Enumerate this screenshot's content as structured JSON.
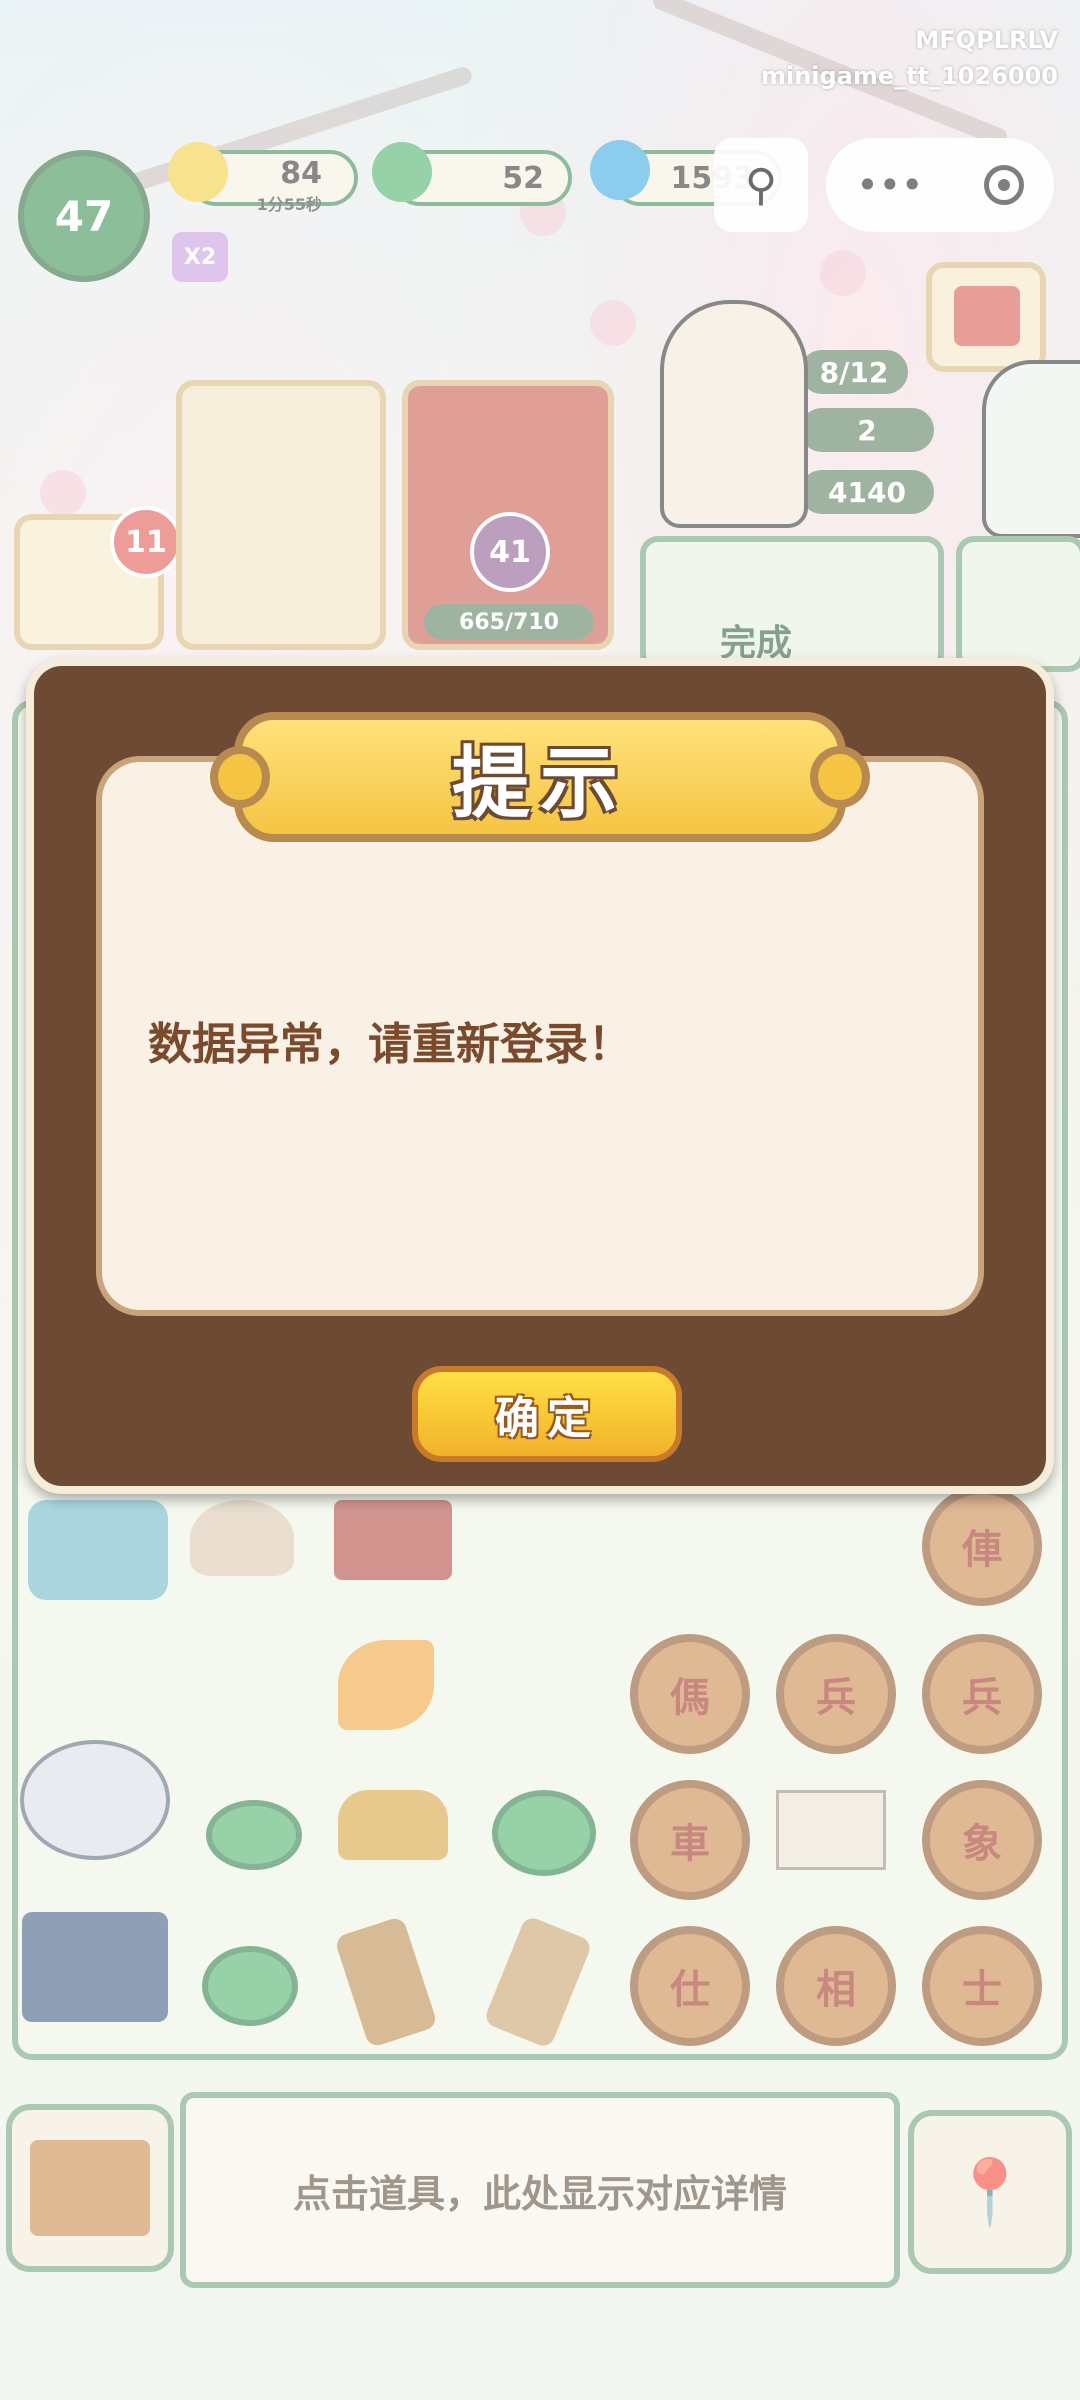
{
  "watermark": {
    "line1": "MFQPLRLV",
    "line2": "minigame_tt_1026000"
  },
  "hud": {
    "level": "47",
    "energy": {
      "value": "84",
      "timer": "1分55秒",
      "icon": "lightning-icon"
    },
    "coins": {
      "value": "52",
      "icon": "jade-coin-icon"
    },
    "gems": {
      "value": "1593",
      "icon": "flame-icon"
    },
    "multiplier": "X2"
  },
  "side_panel": {
    "progress": "8/12",
    "flowers": "2",
    "score": "4140"
  },
  "cards": {
    "notification_count": "11",
    "trophy_level": "41",
    "trophy_progress": "665/710",
    "complete_label": "完成"
  },
  "dialog": {
    "title": "提示",
    "message": "数据异常，请重新登录！",
    "confirm": "确定"
  },
  "board": {
    "chess_pieces": [
      "俥",
      "傌",
      "兵",
      "兵",
      "車",
      "象",
      "仕",
      "相",
      "士"
    ]
  },
  "bottom": {
    "detail_hint": "点击道具，此处显示对应详情"
  },
  "colors": {
    "board_border": "#6fa37a",
    "dialog_frame": "#6d4a34",
    "button": "#f2b12b"
  }
}
